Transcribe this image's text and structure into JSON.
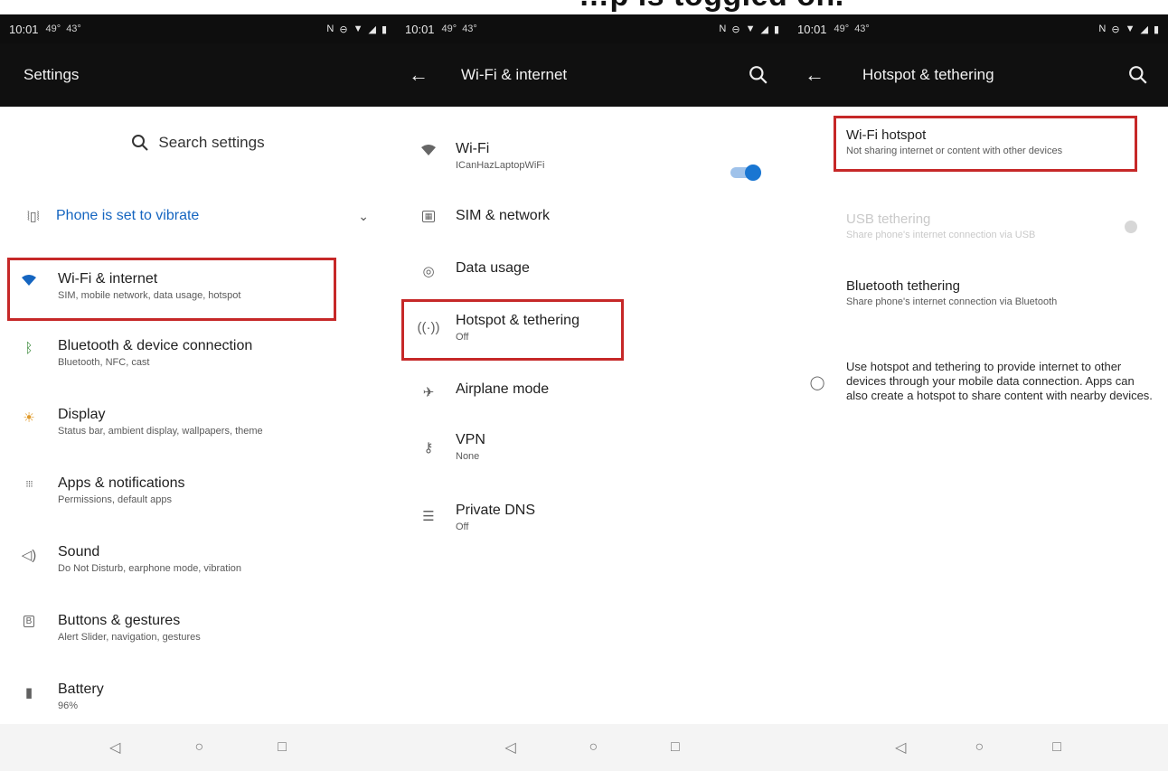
{
  "caption": "…p is toggled on.",
  "status": {
    "time": "10:01",
    "temp1": "49°",
    "temp2": "43°"
  },
  "settings": {
    "title": "Settings",
    "search": "Search settings",
    "vibrate": "Phone is set to vibrate",
    "items": [
      {
        "title": "Wi-Fi & internet",
        "sub": "SIM, mobile network, data usage, hotspot"
      },
      {
        "title": "Bluetooth & device connection",
        "sub": "Bluetooth, NFC, cast"
      },
      {
        "title": "Display",
        "sub": "Status bar, ambient display, wallpapers, theme"
      },
      {
        "title": "Apps & notifications",
        "sub": "Permissions, default apps"
      },
      {
        "title": "Sound",
        "sub": "Do Not Disturb, earphone mode, vibration"
      },
      {
        "title": "Buttons & gestures",
        "sub": "Alert Slider, navigation, gestures"
      },
      {
        "title": "Battery",
        "sub": "96%"
      }
    ]
  },
  "wifi": {
    "title": "Wi-Fi & internet",
    "items": [
      {
        "title": "Wi-Fi",
        "sub": "ICanHazLaptopWiFi"
      },
      {
        "title": "SIM & network",
        "sub": ""
      },
      {
        "title": "Data usage",
        "sub": ""
      },
      {
        "title": "Hotspot & tethering",
        "sub": "Off"
      },
      {
        "title": "Airplane mode",
        "sub": ""
      },
      {
        "title": "VPN",
        "sub": "None"
      },
      {
        "title": "Private DNS",
        "sub": "Off"
      }
    ]
  },
  "hotspot": {
    "title": "Hotspot & tethering",
    "items": [
      {
        "title": "Wi-Fi hotspot",
        "sub": "Not sharing internet or content with other devices"
      },
      {
        "title": "USB tethering",
        "sub": "Share phone's internet connection via USB"
      },
      {
        "title": "Bluetooth tethering",
        "sub": "Share phone's internet connection via Bluetooth"
      }
    ],
    "info": "Use hotspot and tethering to provide internet to other devices through your mobile data connection. Apps can also create a hotspot to share content with nearby devices."
  },
  "nav": {
    "back": "◁",
    "home": "○",
    "recents": "□"
  }
}
